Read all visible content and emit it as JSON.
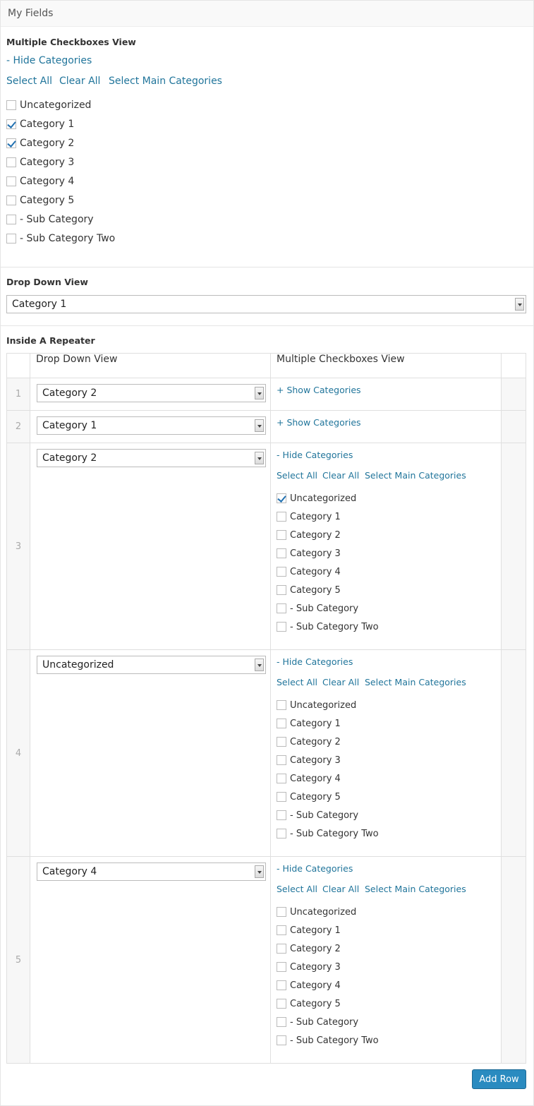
{
  "box": {
    "title": "My Fields"
  },
  "checkbox_field": {
    "label": "Multiple Checkboxes View",
    "toggle": "- Hide Categories",
    "actions": [
      "Select All",
      "Clear All",
      "Select Main Categories"
    ],
    "options": [
      {
        "label": "Uncategorized",
        "checked": false
      },
      {
        "label": "Category 1",
        "checked": true
      },
      {
        "label": "Category 2",
        "checked": true
      },
      {
        "label": "Category 3",
        "checked": false
      },
      {
        "label": "Category 4",
        "checked": false
      },
      {
        "label": "Category 5",
        "checked": false
      },
      {
        "label": "- Sub Category",
        "checked": false
      },
      {
        "label": "- Sub Category Two",
        "checked": false
      }
    ]
  },
  "dropdown_field": {
    "label": "Drop Down View",
    "value": "Category 1"
  },
  "repeater": {
    "label": "Inside A Repeater",
    "columns": [
      "Drop Down View",
      "Multiple Checkboxes View"
    ],
    "rows": [
      {
        "num": "1",
        "dropdown": "Category 2",
        "toggle": "+ Show Categories",
        "expanded": false,
        "checked": []
      },
      {
        "num": "2",
        "dropdown": "Category 1",
        "toggle": "+ Show Categories",
        "expanded": false,
        "checked": []
      },
      {
        "num": "3",
        "dropdown": "Category 2",
        "toggle": "- Hide Categories",
        "expanded": true,
        "checked": [
          0
        ]
      },
      {
        "num": "4",
        "dropdown": "Uncategorized",
        "toggle": "- Hide Categories",
        "expanded": true,
        "checked": []
      },
      {
        "num": "5",
        "dropdown": "Category 4",
        "toggle": "- Hide Categories",
        "expanded": true,
        "checked": []
      }
    ],
    "actions": [
      "Select All",
      "Clear All",
      "Select Main Categories"
    ],
    "options": [
      "Uncategorized",
      "Category 1",
      "Category 2",
      "Category 3",
      "Category 4",
      "Category 5",
      "- Sub Category",
      "- Sub Category Two"
    ]
  },
  "add_row_button": {
    "label": "Add Row"
  }
}
